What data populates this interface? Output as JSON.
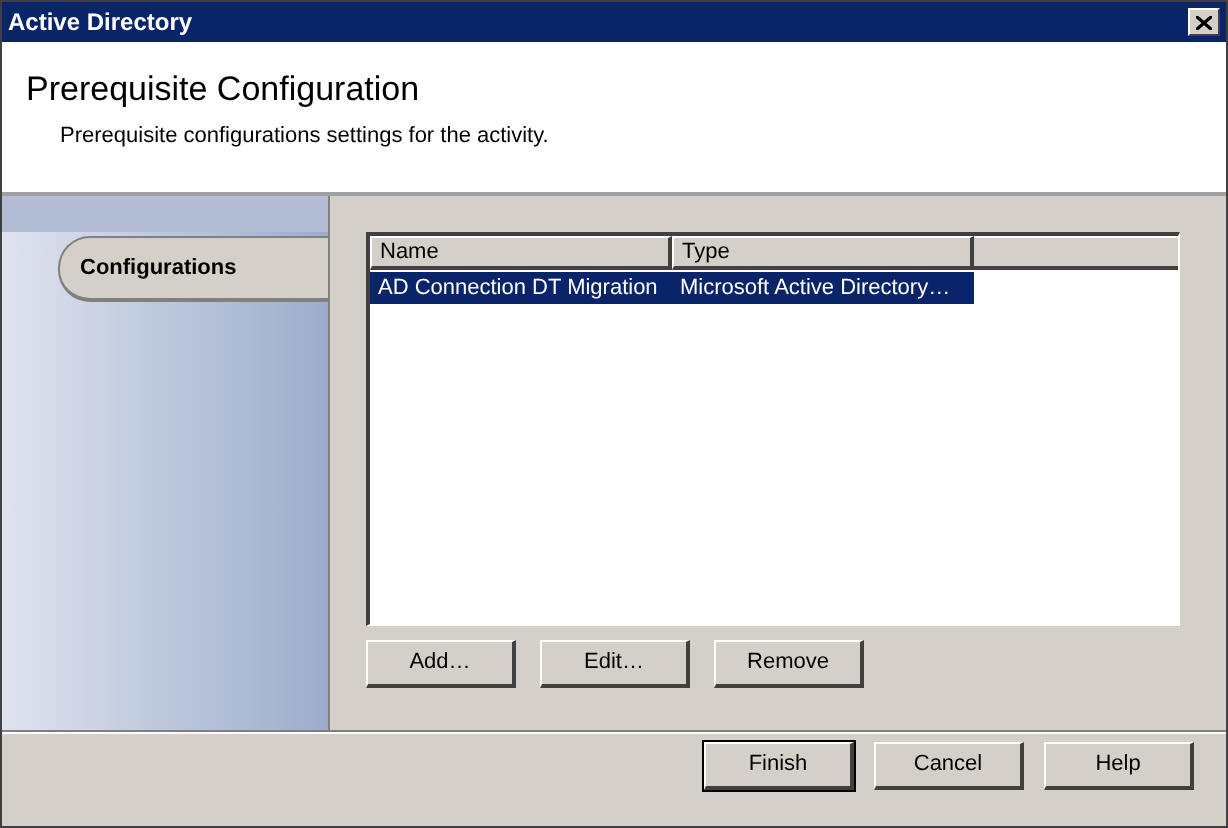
{
  "window": {
    "title": "Active Directory"
  },
  "header": {
    "title": "Prerequisite Configuration",
    "subtitle": "Prerequisite configurations settings for the activity."
  },
  "tabs": [
    {
      "label": "Configurations",
      "selected": true
    }
  ],
  "table": {
    "columns": [
      "Name",
      "Type"
    ],
    "rows": [
      {
        "cells": [
          "AD Connection DT Migration",
          "Microsoft Active Directory…"
        ],
        "selected": true
      }
    ]
  },
  "list_buttons": [
    "Add…",
    "Edit…",
    "Remove"
  ],
  "footer_buttons": [
    {
      "label": "Finish",
      "default": true
    },
    {
      "label": "Cancel",
      "default": false
    },
    {
      "label": "Help",
      "default": false
    }
  ]
}
